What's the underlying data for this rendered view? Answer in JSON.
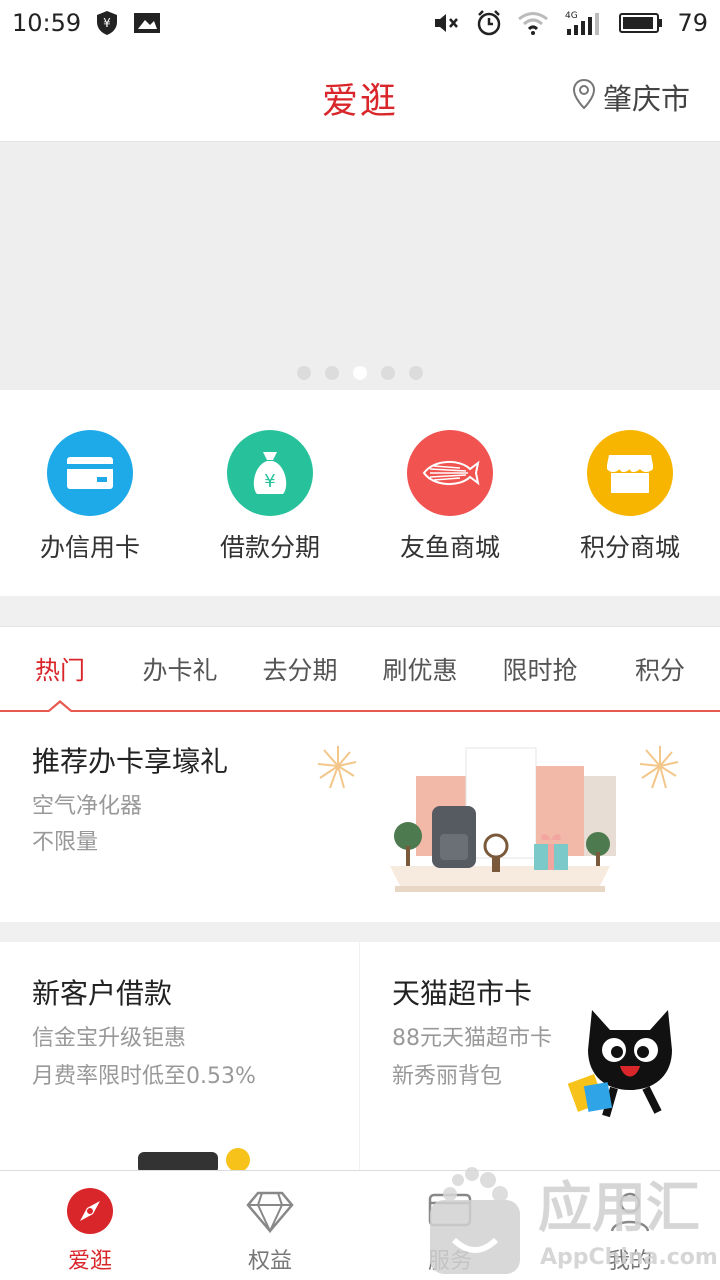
{
  "status_bar": {
    "time": "10:59",
    "battery": "79",
    "network": "4G"
  },
  "header": {
    "title": "爱逛",
    "location": "肇庆市"
  },
  "banner": {
    "dot_count": 5,
    "active_dot": 2
  },
  "quick_menu": [
    {
      "label": "办信用卡",
      "icon": "credit-card-icon",
      "color": "#1ea9e8"
    },
    {
      "label": "借款分期",
      "icon": "money-bag-icon",
      "color": "#27c29b"
    },
    {
      "label": "友鱼商城",
      "icon": "fish-icon",
      "color": "#f05350"
    },
    {
      "label": "积分商城",
      "icon": "shop-icon",
      "color": "#f7b500"
    }
  ],
  "tabs": [
    {
      "label": "热门",
      "active": true
    },
    {
      "label": "办卡礼",
      "active": false
    },
    {
      "label": "去分期",
      "active": false
    },
    {
      "label": "刷优惠",
      "active": false
    },
    {
      "label": "限时抢",
      "active": false
    },
    {
      "label": "积分",
      "active": false
    }
  ],
  "promo": {
    "title": "推荐办卡享壕礼",
    "subtitle1": "空气净化器",
    "subtitle2": "不限量"
  },
  "cards": [
    {
      "title": "新客户借款",
      "subtitle1": "信金宝升级钜惠",
      "subtitle2": "月费率限时低至0.53%"
    },
    {
      "title": "天猫超市卡",
      "subtitle1": "88元天猫超市卡",
      "subtitle2": "新秀丽背包"
    }
  ],
  "bottom_nav": [
    {
      "label": "爱逛",
      "icon": "compass-icon",
      "active": true
    },
    {
      "label": "权益",
      "icon": "diamond-icon",
      "active": false
    },
    {
      "label": "服务",
      "icon": "service-icon",
      "active": false
    },
    {
      "label": "我的",
      "icon": "user-icon",
      "active": false
    }
  ],
  "watermark": {
    "brand_cn": "应用汇",
    "brand_en": "AppChina.com"
  },
  "colors": {
    "accent": "#d9262a",
    "tab_line": "#e85a4f"
  }
}
